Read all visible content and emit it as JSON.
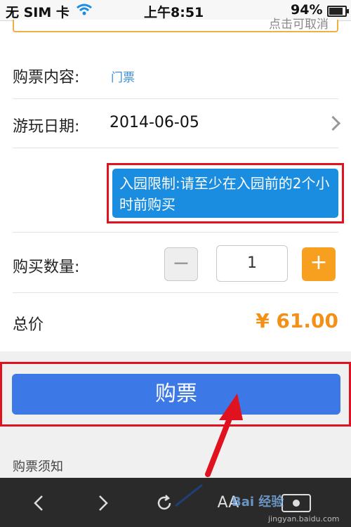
{
  "status_bar": {
    "carrier": "无 SIM 卡",
    "time": "上午8:51",
    "battery": "94%"
  },
  "notice": {
    "text": "点击可取消"
  },
  "ticket_content": {
    "label": "购票内容:",
    "value": "门票"
  },
  "visit_date": {
    "label": "游玩日期:",
    "value": "2014-06-05"
  },
  "tip": {
    "text": "入园限制:请至少在入园前的2个小时前购买"
  },
  "quantity": {
    "label": "购买数量:",
    "value": "1",
    "minus": "−",
    "plus": "+"
  },
  "total": {
    "label": "总价",
    "value": "¥ 61.00"
  },
  "buy_button": {
    "label": "购票"
  },
  "notes": {
    "title": "购票须知"
  },
  "toolbar": {
    "icons": [
      "back-icon",
      "forward-icon",
      "refresh-icon",
      "font-size-icon",
      "baidu-icon"
    ],
    "font_label": "AA"
  },
  "watermark": {
    "brand": "Bai 经验",
    "url": "jingyan.baidu.com"
  },
  "colors": {
    "accent_blue": "#3c78e6",
    "price_orange": "#f39017",
    "highlight_red": "#e0121f",
    "tip_blue": "#1a8de0"
  }
}
